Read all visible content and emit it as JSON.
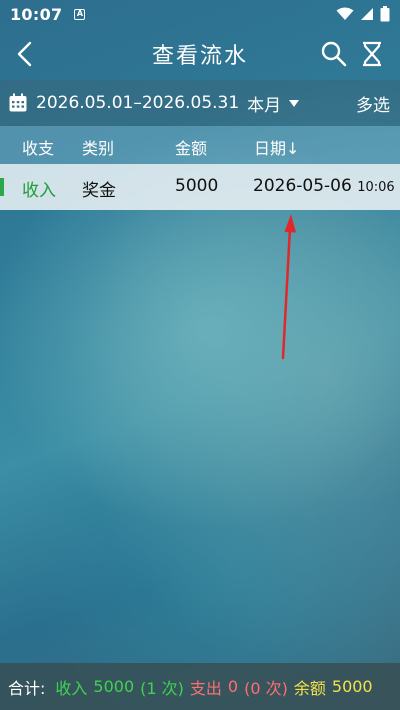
{
  "status_bar": {
    "time": "10:07",
    "app_icon_letter": "A"
  },
  "header": {
    "title": "查看流水"
  },
  "filter": {
    "date_range": "2026.05.01–2026.05.31",
    "period": "本月",
    "multi_select": "多选"
  },
  "table": {
    "columns": [
      "收支",
      "类别",
      "金额",
      "日期↓"
    ],
    "rows": [
      {
        "type": "收入",
        "category": "奖金",
        "amount": "5000",
        "date": "2026-05-06",
        "time": "10:06"
      }
    ]
  },
  "summary": {
    "label": "合计:",
    "income_label": "收入",
    "income_amount": "5000",
    "income_count": "(1 次)",
    "expense_label": "支出",
    "expense_amount": "0",
    "expense_count": "(0 次)",
    "balance_label": "余额",
    "balance_amount": "5000"
  },
  "colors": {
    "income": "#3fd34f",
    "expense": "#ff6f6f",
    "balance": "#f3e24a",
    "annotation_arrow": "#e0282b"
  },
  "icons": [
    "back-arrow-icon",
    "search-icon",
    "hourglass-icon",
    "calendar-icon",
    "dropdown-caret-icon",
    "wifi-icon",
    "signal-icon",
    "battery-icon"
  ]
}
